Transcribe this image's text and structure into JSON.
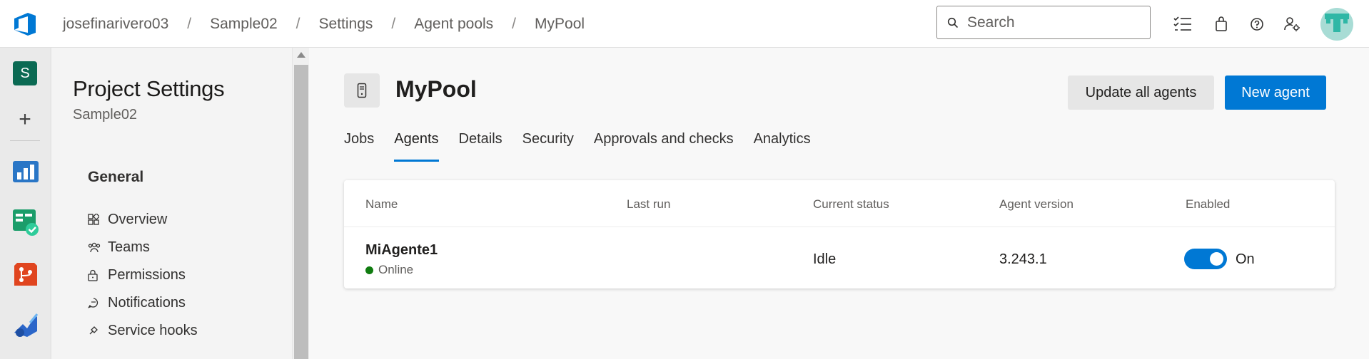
{
  "header": {
    "breadcrumbs": [
      "josefinarivero03",
      "Sample02",
      "Settings",
      "Agent pools",
      "MyPool"
    ],
    "separator": "/",
    "search_placeholder": "Search",
    "icons": [
      "logo-icon",
      "task-list-icon",
      "shopping-bag-icon",
      "help-icon",
      "user-settings-icon",
      "avatar"
    ]
  },
  "rail": {
    "project_initial": "S",
    "add_label": "+",
    "apps": [
      "overview-app-icon",
      "boards-app-icon",
      "repos-app-icon",
      "pipelines-app-icon"
    ],
    "colors": {
      "project": "#0b6a53"
    }
  },
  "settings": {
    "title": "Project Settings",
    "subtitle": "Sample02",
    "group": "General",
    "items": [
      {
        "label": "Overview",
        "icon": "overview-icon"
      },
      {
        "label": "Teams",
        "icon": "teams-icon"
      },
      {
        "label": "Permissions",
        "icon": "lock-icon"
      },
      {
        "label": "Notifications",
        "icon": "chat-icon"
      },
      {
        "label": "Service hooks",
        "icon": "plug-icon"
      }
    ]
  },
  "pool": {
    "title": "MyPool",
    "update_button": "Update all agents",
    "new_button": "New agent",
    "tabs": [
      {
        "label": "Jobs",
        "active": false
      },
      {
        "label": "Agents",
        "active": true
      },
      {
        "label": "Details",
        "active": false
      },
      {
        "label": "Security",
        "active": false
      },
      {
        "label": "Approvals and checks",
        "active": false
      },
      {
        "label": "Analytics",
        "active": false
      }
    ]
  },
  "table": {
    "columns": [
      "Name",
      "Last run",
      "Current status",
      "Agent version",
      "Enabled"
    ],
    "rows": [
      {
        "name": "MiAgente1",
        "online": "Online",
        "last_run": "",
        "status": "Idle",
        "version": "3.243.1",
        "enabled": true,
        "enabled_label": "On"
      }
    ]
  },
  "colors": {
    "accent": "#0078d4",
    "online": "#107c10"
  }
}
